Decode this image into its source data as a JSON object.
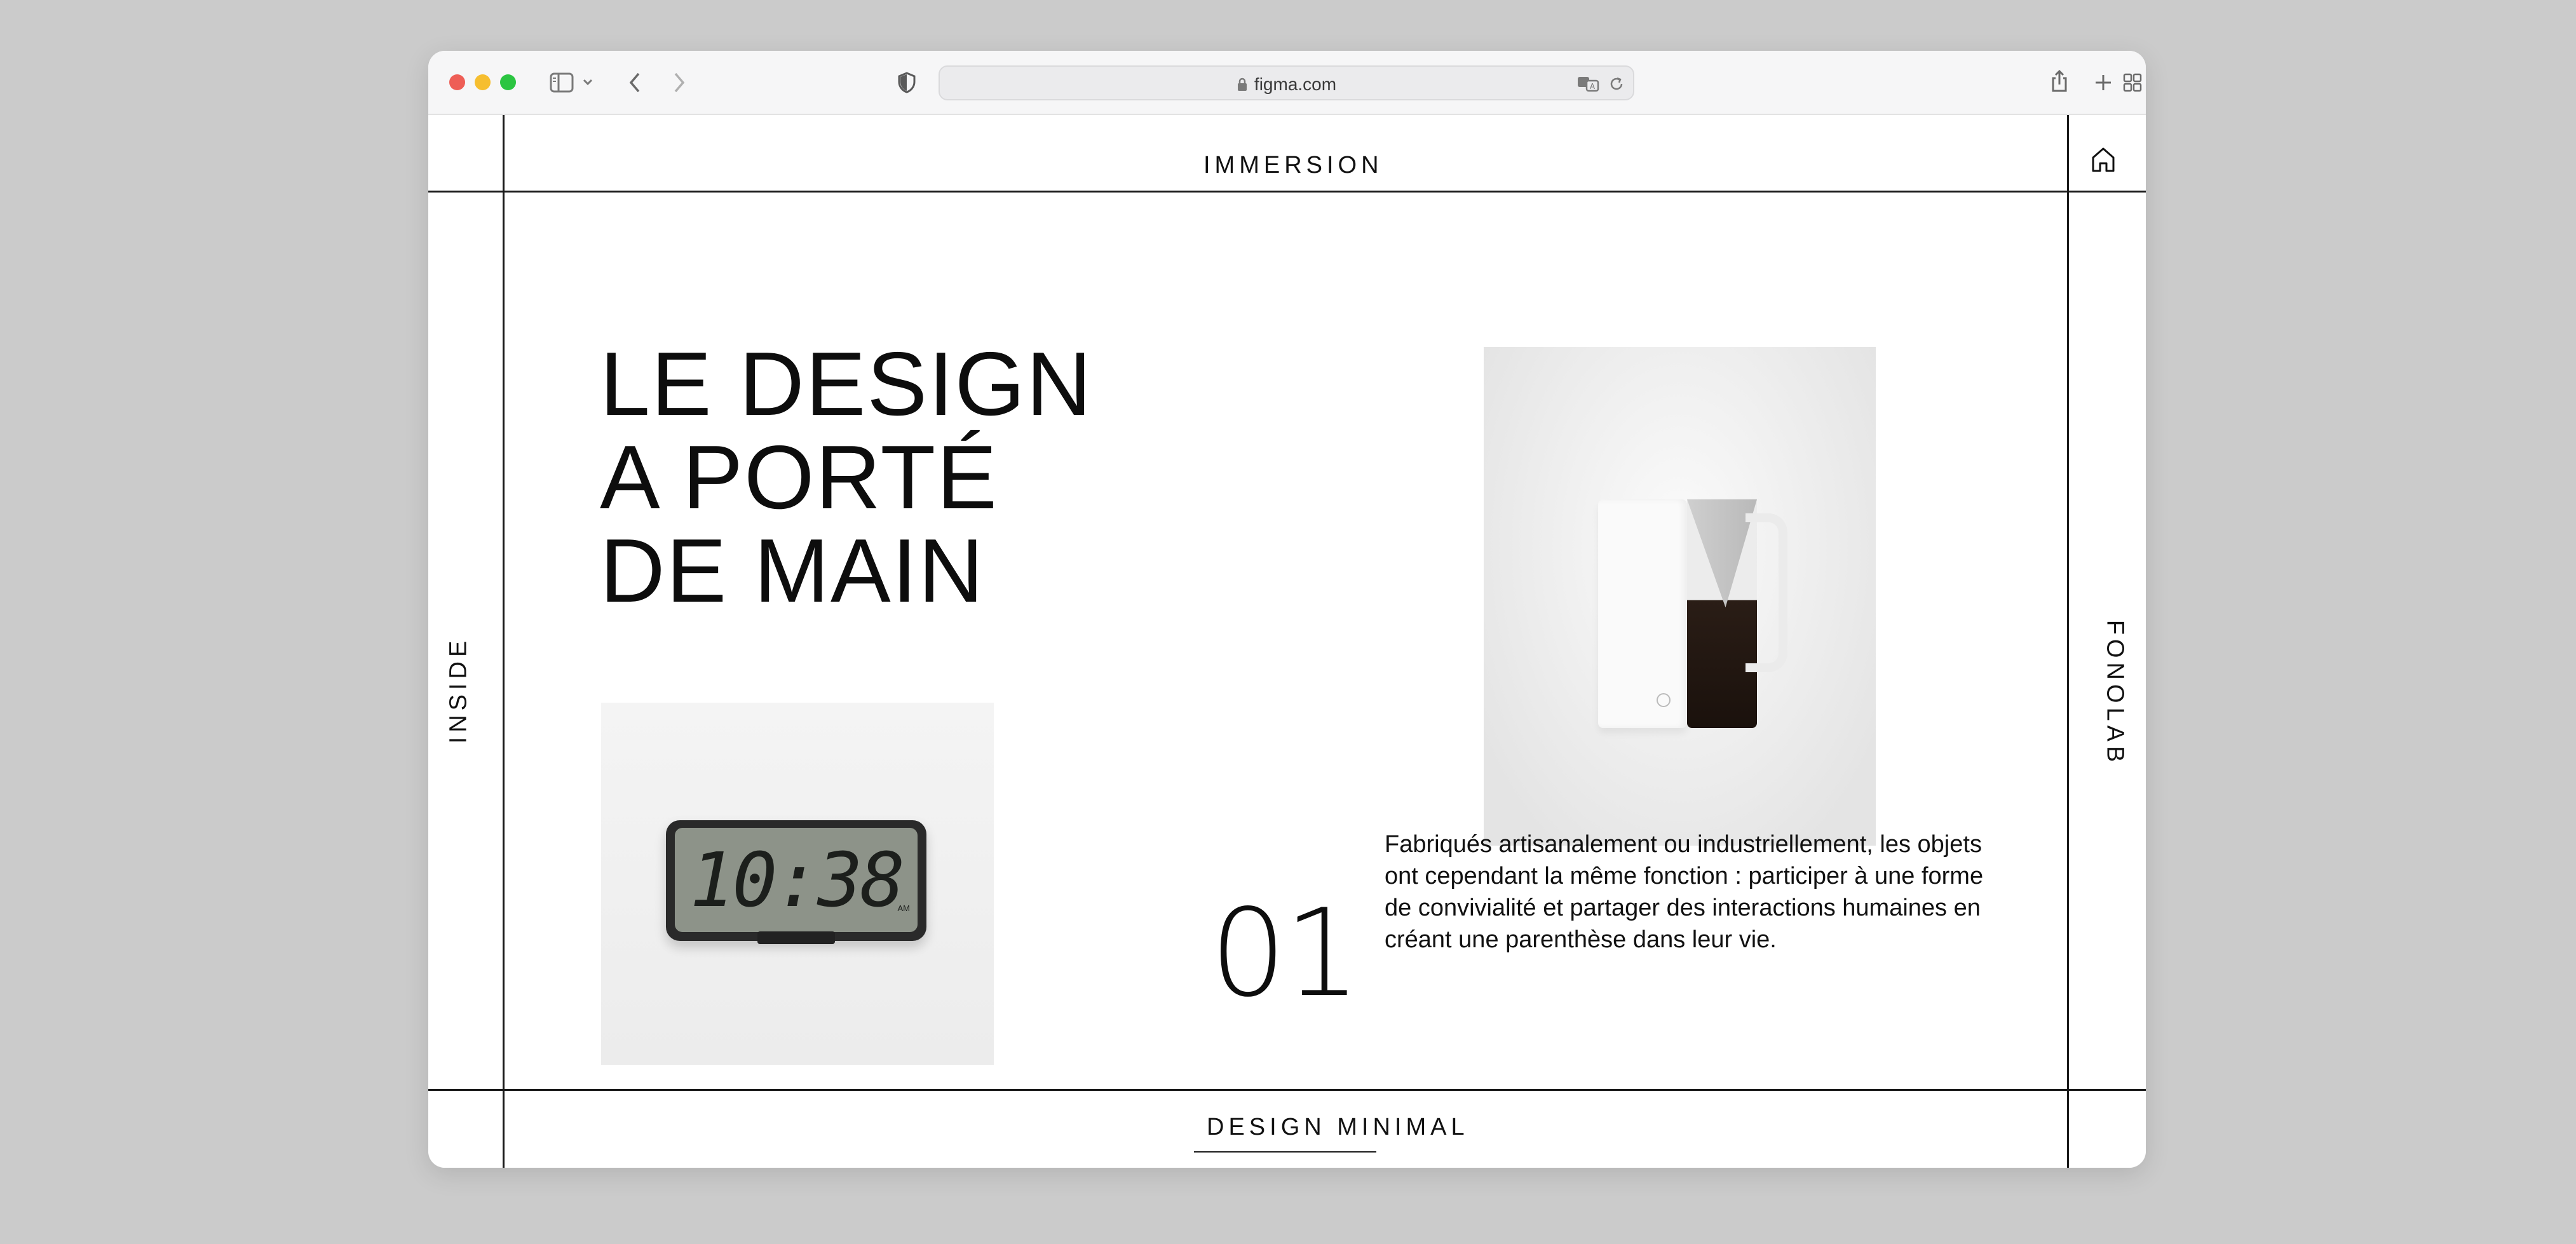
{
  "browser": {
    "url": "figma.com",
    "traffic_lights": {
      "close": "#ee5e56",
      "minimize": "#f6be2f",
      "zoom": "#2bc541"
    },
    "icons": [
      "sidebar-icon",
      "chevron-down-icon",
      "back-arrow-icon",
      "forward-arrow-icon",
      "shield-icon",
      "lock-icon",
      "translate-icon",
      "reload-icon",
      "share-icon",
      "new-tab-icon",
      "tab-overview-icon"
    ]
  },
  "page": {
    "top_label": "IMMERSION",
    "left_label": "INSIDE",
    "right_label": "FONOLAB",
    "bottom_label": "DESIGN MINIMAL",
    "headline": [
      "LE DESIGN",
      "A PORTÉ",
      "DE MAIN"
    ],
    "number": "01",
    "paragraph": "Fabriqués artisanalement ou industriellement, les objets ont cependant la même fonction : participer à une forme de convivialité et partager des interactions humaines en créant une parenthèse dans leur vie.",
    "clock_time": "10:38",
    "clock_suffix": "AM",
    "home_icon": "home-icon"
  }
}
